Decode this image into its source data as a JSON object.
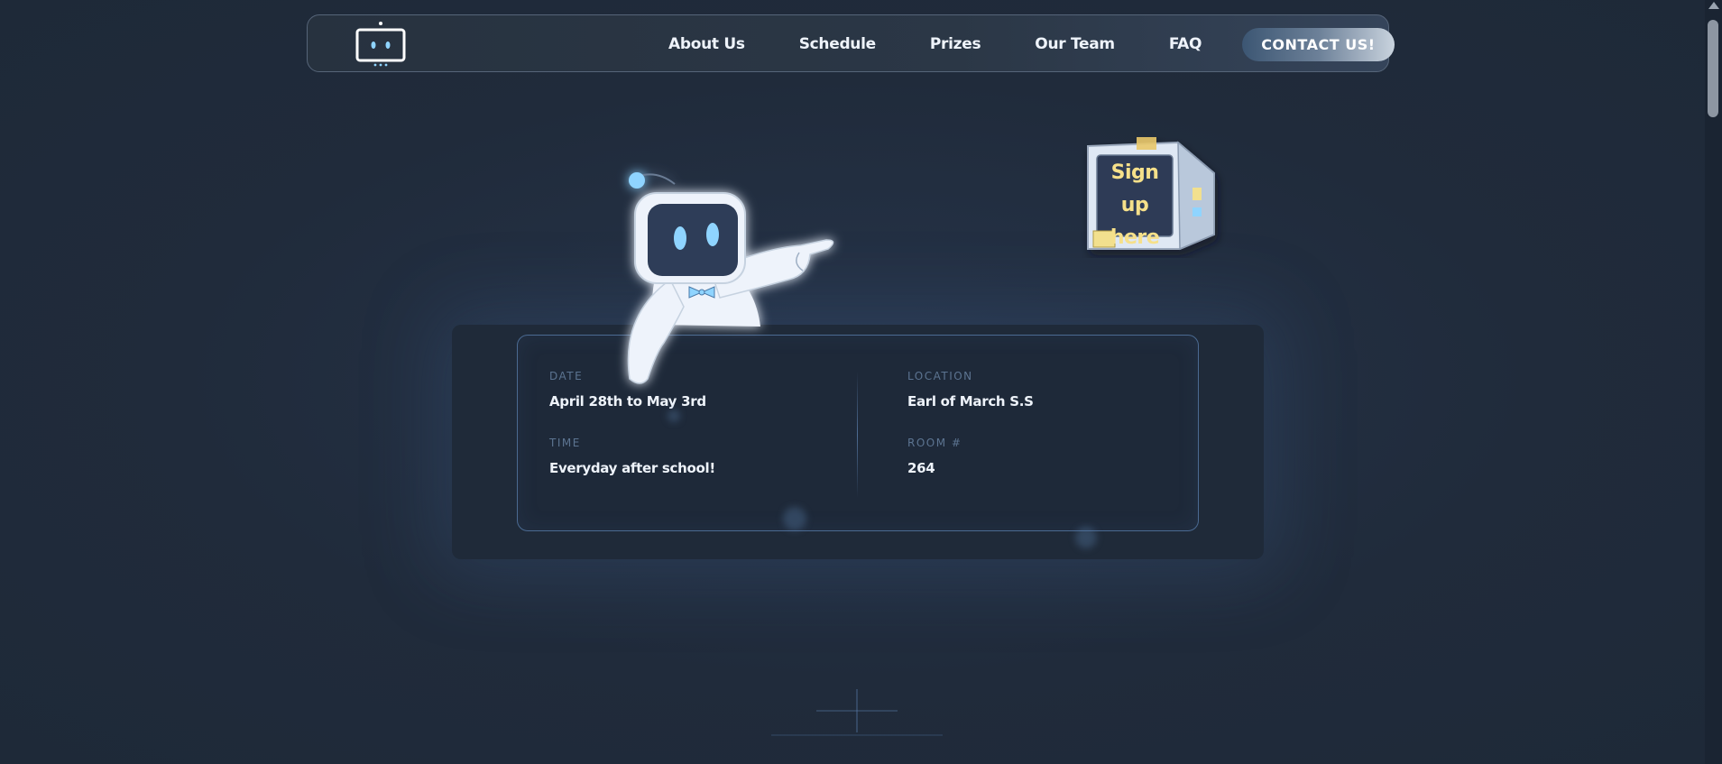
{
  "nav": {
    "links": [
      {
        "label": "About Us"
      },
      {
        "label": "Schedule"
      },
      {
        "label": "Prizes"
      },
      {
        "label": "Our Team"
      },
      {
        "label": "FAQ"
      }
    ],
    "contact_label": "CONTACT US!"
  },
  "hero": {
    "signup_label_line1": "Sign up",
    "signup_label_line2": "here"
  },
  "info": {
    "date_label": "DATE",
    "date_value": "April 28th to May 3rd",
    "time_label": "TIME",
    "time_value": "Everyday after school!",
    "location_label": "LOCATION",
    "location_value": "Earl of March S.S",
    "room_label": "ROOM #",
    "room_value": "264"
  },
  "colors": {
    "background": "#202b3b",
    "accent": "#7cc8f2",
    "card_border": "#4b6a92",
    "signup_text": "#f6e08a"
  }
}
